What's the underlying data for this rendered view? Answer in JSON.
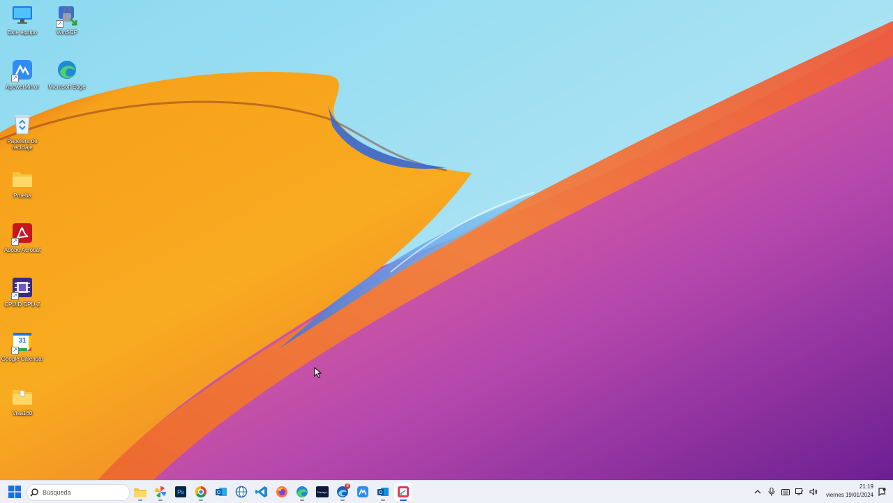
{
  "desktop": {
    "icons": [
      {
        "label": "Este equipo",
        "icon": "monitor-icon"
      },
      {
        "label": "WinSCP",
        "icon": "winscp-icon"
      },
      {
        "label": "ApowerMirror",
        "icon": "apowermirror-icon"
      },
      {
        "label": "Microsoft Edge",
        "icon": "edge-icon"
      },
      {
        "label": "Papelera de reciclaje",
        "icon": "recycle-bin-icon"
      },
      {
        "label": "Prueba",
        "icon": "folder-icon"
      },
      {
        "label": "Adobe Acrobat",
        "icon": "acrobat-icon"
      },
      {
        "label": "CPUID CPU-Z",
        "icon": "cpuz-icon"
      },
      {
        "label": "Google Calendar",
        "icon": "calendar-icon"
      },
      {
        "label": "Visa160",
        "icon": "folder-icon"
      }
    ],
    "calendar_day": "31"
  },
  "taskbar": {
    "search_placeholder": "Búsqueda",
    "apps": [
      {
        "name": "file-explorer",
        "icon": "folder-icon"
      },
      {
        "name": "photos",
        "icon": "pinwheel-icon"
      },
      {
        "name": "photoshop",
        "icon": "photoshop-icon",
        "text": "Ps"
      },
      {
        "name": "chrome",
        "icon": "chrome-icon"
      },
      {
        "name": "outlook",
        "icon": "outlook-icon"
      },
      {
        "name": "browser-globe",
        "icon": "globe-icon"
      },
      {
        "name": "vscode",
        "icon": "vscode-icon"
      },
      {
        "name": "firefox",
        "icon": "firefox-icon"
      },
      {
        "name": "edge",
        "icon": "edge-icon"
      },
      {
        "name": "disney-plus",
        "icon": "disney-icon",
        "text": "Disney+"
      },
      {
        "name": "edge-dev",
        "icon": "edge-dev-icon",
        "badge": "8"
      },
      {
        "name": "apowermirror",
        "icon": "apowermirror-icon"
      },
      {
        "name": "outlook-new",
        "icon": "outlook-icon"
      },
      {
        "name": "snipping-tool",
        "icon": "snipping-icon"
      }
    ],
    "tray": {
      "time": "21:19",
      "date": "viernes 19/01/2024"
    }
  },
  "colors": {
    "taskbar_bg": "#eef0f7",
    "accent": "#1b64d6",
    "wallpaper_orange": "#f6a21b",
    "wallpaper_magenta": "#b03aa8"
  }
}
